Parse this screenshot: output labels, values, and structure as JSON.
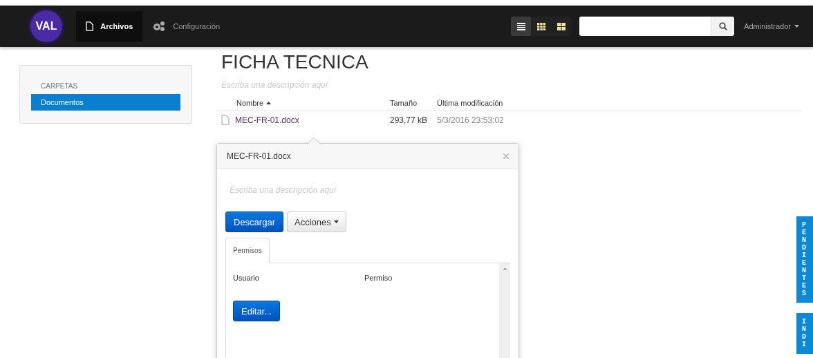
{
  "navbar": {
    "logo": "VAL",
    "tabs": [
      {
        "label": "Archivos",
        "kind": "file",
        "selected": true
      },
      {
        "label": "Configuración",
        "kind": "gears",
        "selected": false
      }
    ],
    "view_modes": [
      {
        "kind": "list",
        "selected": true
      },
      {
        "kind": "grid",
        "selected": false
      },
      {
        "kind": "tiles",
        "selected": false
      }
    ],
    "user_menu": "Administrador"
  },
  "sidebar": {
    "heading": "CARPETAS",
    "items": [
      {
        "label": "Documentos",
        "selected": true
      }
    ]
  },
  "folder": {
    "title": "FICHA TECNICA",
    "description_placeholder": "Escriba una descripción aquí",
    "columns": [
      {
        "label": "Nombre",
        "sorted": true
      },
      {
        "label": "Tamaño",
        "sorted": false
      },
      {
        "label": "Última modificación",
        "sorted": false
      }
    ],
    "rows": [
      {
        "name": "MEC-FR-01.docx",
        "size": "293,77 kB",
        "modified": "5/3/2016 23:53:02"
      }
    ]
  },
  "popover": {
    "title": "MEC-FR-01.docx",
    "description_placeholder": "Escriba una descripción aquí",
    "download_button": "Descargar",
    "actions_button": "Acciones",
    "tabs": [
      {
        "label": "Permisos",
        "selected": true
      }
    ],
    "columns": [
      "Usuario",
      "Permiso"
    ],
    "edit_button": "Editar..."
  },
  "side_tabs": [
    "PENDIENTES",
    "INDI"
  ]
}
